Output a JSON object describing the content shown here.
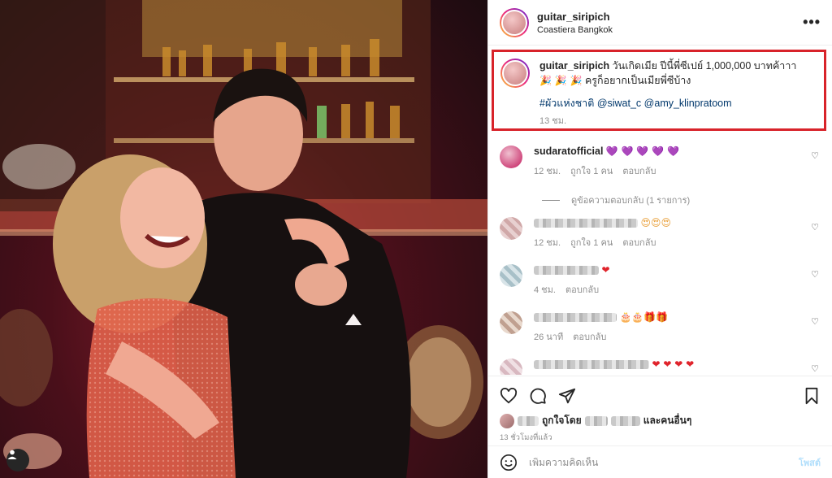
{
  "header": {
    "username": "guitar_siripich",
    "location": "Coastiera Bangkok",
    "more_label": "•••"
  },
  "caption": {
    "username": "guitar_siripich",
    "line1": "วันเกิดเมีย ปีนี้พี่ซีเปย์ 1,000,000 บาทค้าาา",
    "line2_emoji": "🎉 🎉 🎉",
    "line2": "ครูก็อยากเป็นเมียพี่ซีบ้าง",
    "hashtag": "#ผัวแห่งชาติ",
    "mention1": "@siwat_c",
    "mention2": "@amy_klinpratoom",
    "time": "13 ชม."
  },
  "comments": [
    {
      "username": "sudaratofficial",
      "text": "💜 💜 💜 💜 💜",
      "time": "12 ชม.",
      "likes": "ถูกใจ 1 คน",
      "reply": "ตอบกลับ",
      "view_replies": "ดูข้อความตอบกลับ (1 รายการ)"
    },
    {
      "username": "",
      "text": "😍😍😍",
      "time": "12 ชม.",
      "likes": "ถูกใจ 1 คน",
      "reply": "ตอบกลับ"
    },
    {
      "username": "",
      "text": "❤",
      "time": "4 ชม.",
      "reply": "ตอบกลับ"
    },
    {
      "username": "",
      "text": "🎂🎂🎁🎁",
      "time": "26 นาที",
      "reply": "ตอบกลับ"
    },
    {
      "username": "",
      "text": "❤ ❤ ❤ ❤"
    }
  ],
  "footer": {
    "liked_by_prefix": "ถูกใจโดย",
    "liked_by_suffix": "และคนอื่นๆ",
    "timestamp": "13 ชั่วโมงที่แล้ว",
    "add_comment_placeholder": "เพิ่มความคิดเห็น",
    "post_label": "โพสต์"
  },
  "icons": {
    "like": "heart-icon",
    "comment": "comment-icon",
    "share": "paper-plane-icon",
    "save": "bookmark-icon",
    "emoji": "smiley-icon",
    "more": "ellipsis-icon"
  },
  "colors": {
    "highlight_border": "#d8232a",
    "link": "#00376b",
    "secondary_text": "#8e8e8e",
    "post_button": "#b2dffc"
  }
}
